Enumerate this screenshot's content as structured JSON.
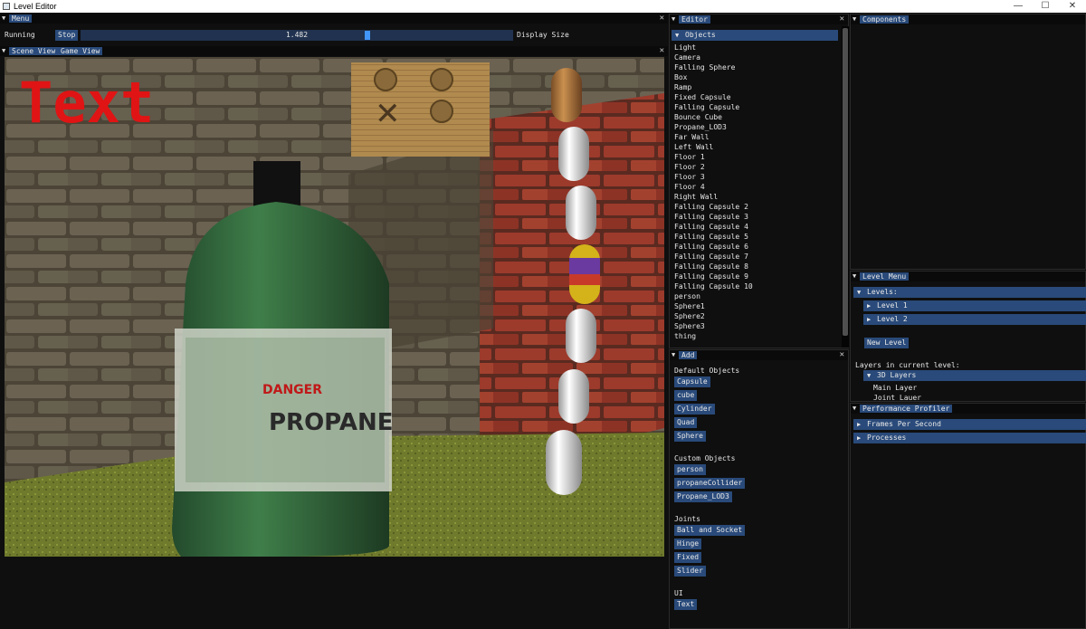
{
  "window": {
    "title": "Level Editor",
    "minimize": "—",
    "maximize": "☐",
    "close": "✕"
  },
  "menu": {
    "title": "Menu",
    "status": "Running",
    "stop_label": "Stop",
    "slider_value": "1.482",
    "slider_fraction": 0.665,
    "display_size_label": "Display Size"
  },
  "scene": {
    "tab_scene": "Scene View",
    "tab_game": "Game View",
    "overlay_text": "Text",
    "label_text": "PROPANE",
    "label_top": "DANGER"
  },
  "editor": {
    "title": "Editor",
    "objects_header": "Objects",
    "objects": [
      "Light",
      "Camera",
      "Falling Sphere",
      "Box",
      "Ramp",
      "Fixed Capsule",
      "Falling Capsule",
      "Bounce Cube",
      "Propane_LOD3",
      "Far Wall",
      "Left Wall",
      "Floor 1",
      "Floor 2",
      "Floor 3",
      "Floor 4",
      "Right Wall",
      "Falling Capsule 2",
      "Falling Capsule 3",
      "Falling Capsule 4",
      "Falling Capsule 5",
      "Falling Capsule 6",
      "Falling Capsule 7",
      "Falling Capsule 8",
      "Falling Capsule 9",
      "Falling Capsule 10",
      "person",
      "Sphere1",
      "Sphere2",
      "Sphere3",
      "thing"
    ]
  },
  "add": {
    "title": "Add",
    "default_header": "Default Objects",
    "defaults": [
      "Capsule",
      "cube",
      "Cylinder",
      "Quad",
      "Sphere"
    ],
    "custom_header": "Custom Objects",
    "customs": [
      "person",
      "propaneCollider",
      "Propane_LOD3"
    ],
    "joints_header": "Joints",
    "joints": [
      "Ball and Socket",
      "Hinge",
      "Fixed",
      "Slider"
    ],
    "ui_header": "UI",
    "ui_items": [
      "Text"
    ]
  },
  "components": {
    "title": "Components"
  },
  "level_menu": {
    "title": "Level Menu",
    "levels_header": "Levels:",
    "levels": [
      "Level 1",
      "Level 2"
    ],
    "new_level": "New Level",
    "layers_label": "Layers in current level:",
    "layers_header": "3D Layers",
    "layers": [
      "Main Layer",
      "Joint Lauer"
    ]
  },
  "profiler": {
    "title": "Performance Profiler",
    "fps": "Frames Per Second",
    "processes": "Processes"
  },
  "colors": {
    "header": "#294a7a",
    "accent": "#4296fa",
    "bg": "#0f0f0f"
  }
}
